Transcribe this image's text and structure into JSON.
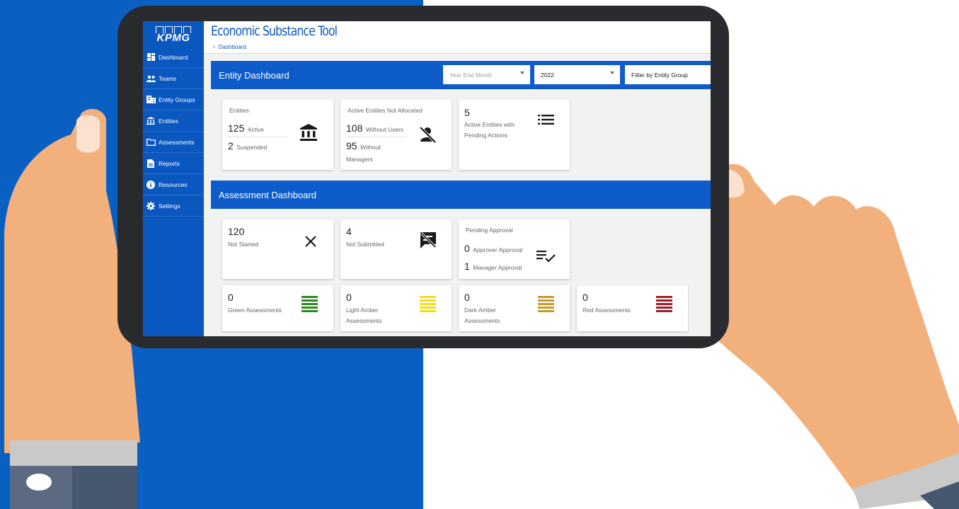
{
  "app": {
    "logo": "KPMG",
    "title": "Economic Substance Tool",
    "breadcrumb": "Dashboard"
  },
  "sidebar": {
    "items": [
      {
        "label": "Dashboard",
        "icon": "dashboard-icon"
      },
      {
        "label": "Teams",
        "icon": "people-icon"
      },
      {
        "label": "Entity Groups",
        "icon": "building-icon"
      },
      {
        "label": "Entities",
        "icon": "bank-icon"
      },
      {
        "label": "Assessments",
        "icon": "folder-icon"
      },
      {
        "label": "Reports",
        "icon": "report-icon"
      },
      {
        "label": "Resources",
        "icon": "info-icon"
      },
      {
        "label": "Settings",
        "icon": "gear-icon"
      }
    ]
  },
  "entity_dashboard": {
    "title": "Entity Dashboard",
    "filters": {
      "year_end_month_placeholder": "Year End Month",
      "year_value": "2022",
      "entity_group_placeholder": "Filter by Entity Group"
    },
    "entities_card": {
      "label": "Entities",
      "active_count": "125",
      "active_label": "Active",
      "suspended_count": "2",
      "suspended_label": "Suspended"
    },
    "not_allocated_card": {
      "label": "Active Entities Not Allocated",
      "without_users_count": "108",
      "without_users_label": "Without Users",
      "without_managers_count": "95",
      "without_managers_label_1": "Without",
      "without_managers_label_2": "Managers"
    },
    "pending_actions_card": {
      "count": "5",
      "label_1": "Active Entities with",
      "label_2": "Pending Actions"
    }
  },
  "assessment_dashboard": {
    "title": "Assessment Dashboard",
    "not_started": {
      "count": "120",
      "label": "Not Started"
    },
    "not_submitted": {
      "count": "4",
      "label": "Not Submitted"
    },
    "pending_approval": {
      "label": "Pending Approval",
      "approver_count": "0",
      "approver_label": "Approver Approval",
      "manager_count": "1",
      "manager_label": "Manager Approval"
    },
    "rag": [
      {
        "count": "0",
        "label_1": "Green Assessments",
        "label_2": "",
        "color": "#2e8b1f"
      },
      {
        "count": "0",
        "label_1": "Light Amber",
        "label_2": "Assessments",
        "color": "#f2dc1d"
      },
      {
        "count": "0",
        "label_1": "Dark Amber",
        "label_2": "Assessments",
        "color": "#c49a2c"
      },
      {
        "count": "0",
        "label_1": "Red Assessments",
        "label_2": "",
        "color": "#a11e24"
      }
    ]
  }
}
